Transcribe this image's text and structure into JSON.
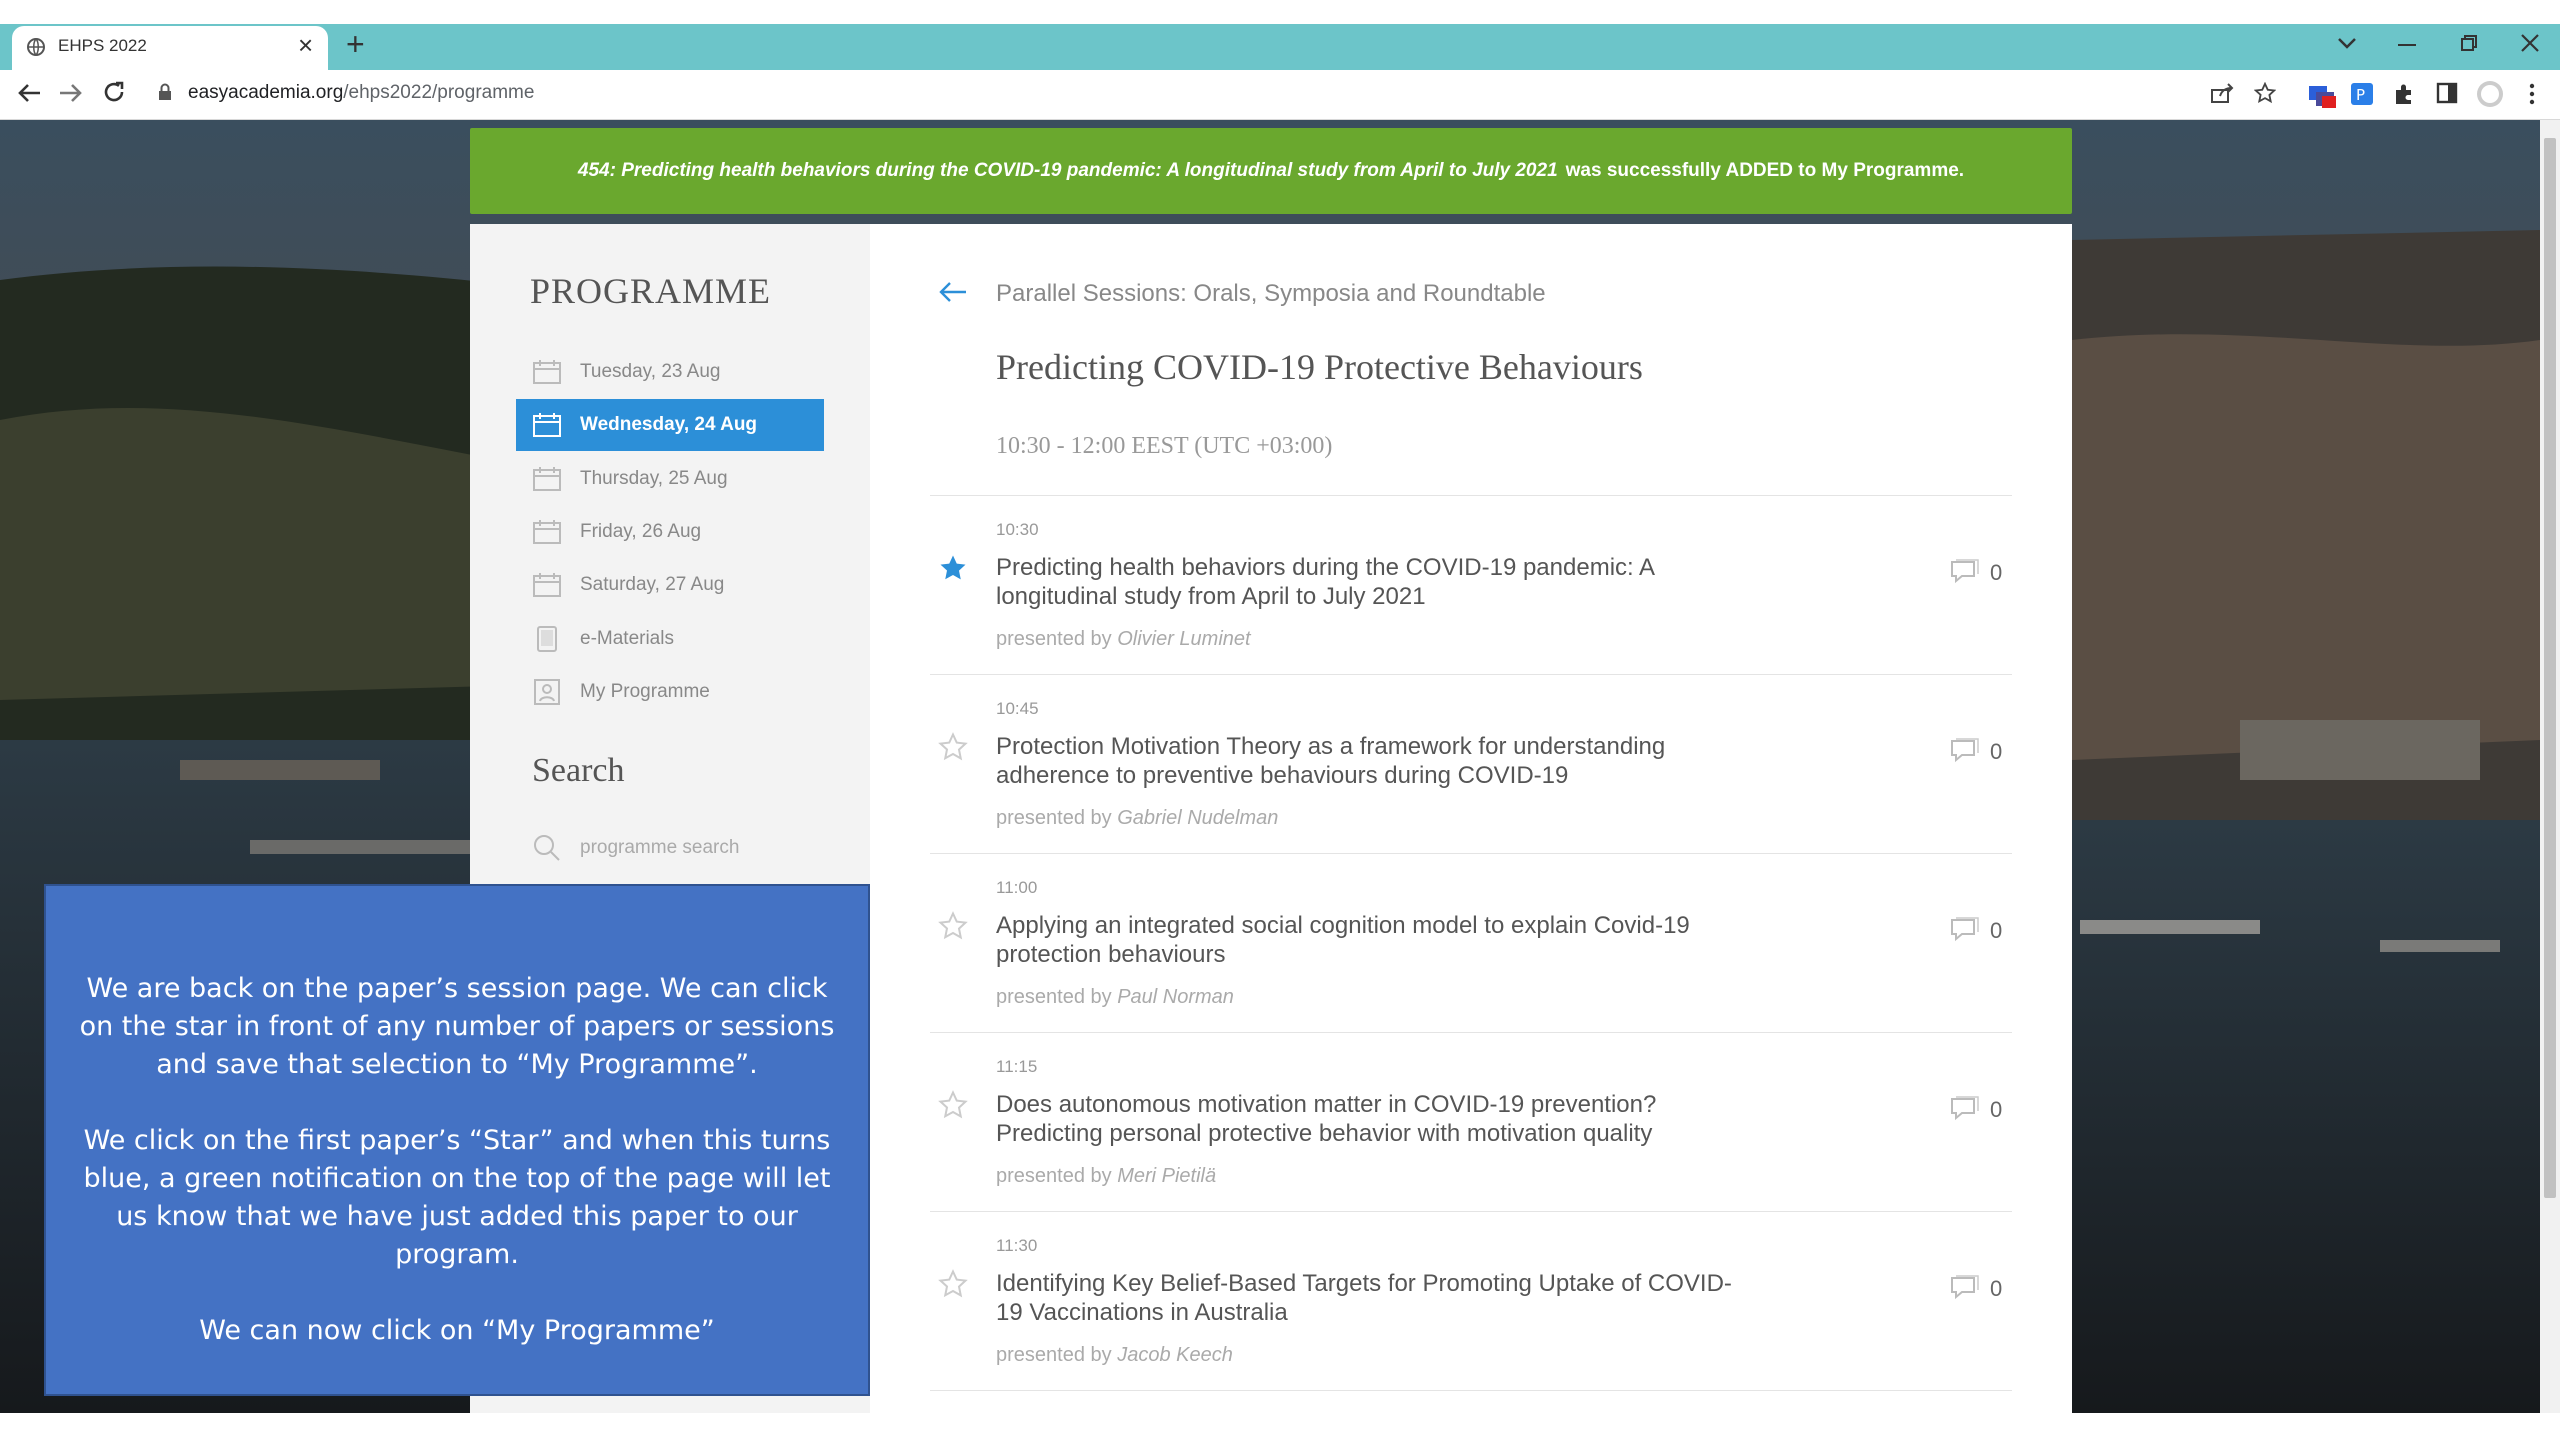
{
  "browser": {
    "tab_title": "EHPS 2022",
    "url_domain": "easyacademia.org",
    "url_path": "/ehps2022/programme",
    "new_tab_glyph": "+",
    "close_glyph": "×",
    "icons": [
      "globe-icon",
      "close-icon",
      "plus-icon",
      "back-icon",
      "forward-icon",
      "reload-icon",
      "lock-icon",
      "share-icon",
      "bookmark-star-icon",
      "extension-icon",
      "puzzle-icon",
      "sidebar-icon",
      "profile-icon",
      "menu-icon",
      "chevron-down-icon",
      "minimize-icon",
      "restore-icon",
      "window-close-icon"
    ]
  },
  "notification": {
    "paper": "454: Predicting health behaviors during the COVID-19 pandemic: A longitudinal study from April to July 2021",
    "message": "was successfully ADDED to My Programme."
  },
  "sidebar": {
    "title": "PROGRAMME",
    "items": [
      {
        "label": "Tuesday, 23 Aug",
        "icon": "calendar-icon",
        "active": false
      },
      {
        "label": "Wednesday, 24 Aug",
        "icon": "calendar-icon",
        "active": true
      },
      {
        "label": "Thursday, 25 Aug",
        "icon": "calendar-icon",
        "active": false
      },
      {
        "label": "Friday, 26 Aug",
        "icon": "calendar-icon",
        "active": false
      },
      {
        "label": "Saturday, 27 Aug",
        "icon": "calendar-icon",
        "active": false
      },
      {
        "label": "e-Materials",
        "icon": "document-icon",
        "active": false
      },
      {
        "label": "My Programme",
        "icon": "person-icon",
        "active": false
      }
    ],
    "search_title": "Search",
    "search_placeholder": "programme search"
  },
  "session": {
    "breadcrumb": "Parallel Sessions: Orals, Symposia and Roundtable",
    "title": "Predicting COVID-19 Protective Behaviours",
    "time": "10:30 - 12:00 EEST (UTC +03:00)",
    "presented_by_label": "presented by",
    "papers": [
      {
        "time": "10:30",
        "title": "Predicting health behaviors during the COVID-19 pandemic: A longitudinal study from April to July 2021",
        "presenter": "Olivier Luminet",
        "comments": "0",
        "starred": true
      },
      {
        "time": "10:45",
        "title": "Protection Motivation Theory as a framework for understanding adherence to preventive behaviours during COVID-19",
        "presenter": "Gabriel Nudelman",
        "comments": "0",
        "starred": false
      },
      {
        "time": "11:00",
        "title": "Applying an integrated social cognition model to explain Covid-19 protection behaviours",
        "presenter": "Paul Norman",
        "comments": "0",
        "starred": false
      },
      {
        "time": "11:15",
        "title": "Does autonomous motivation matter in COVID-19 prevention? Predicting personal protective behavior with motivation quality",
        "presenter": "Meri Pietilä",
        "comments": "0",
        "starred": false
      },
      {
        "time": "11:30",
        "title": "Identifying Key Belief-Based Targets for Promoting Uptake of COVID-19 Vaccinations in Australia",
        "presenter": "Jacob Keech",
        "comments": "0",
        "starred": false
      }
    ]
  },
  "overlay": {
    "paragraphs": [
      "We are back on the paper’s session page. We can click on the star in front of any number of papers or sessions and save that selection to “My Programme”.",
      "We click on the first paper’s “Star” and when this turns blue, a green notification on the top of the page will let us know that we have just added this paper to our program.",
      "We  can now click on “My Programme”"
    ]
  },
  "colors": {
    "tabstrip": "#6cc5c9",
    "notification": "#6aa82e",
    "active_day": "#2c8fd8",
    "star_active": "#2c8fd8",
    "overlay": "#4472c4"
  }
}
